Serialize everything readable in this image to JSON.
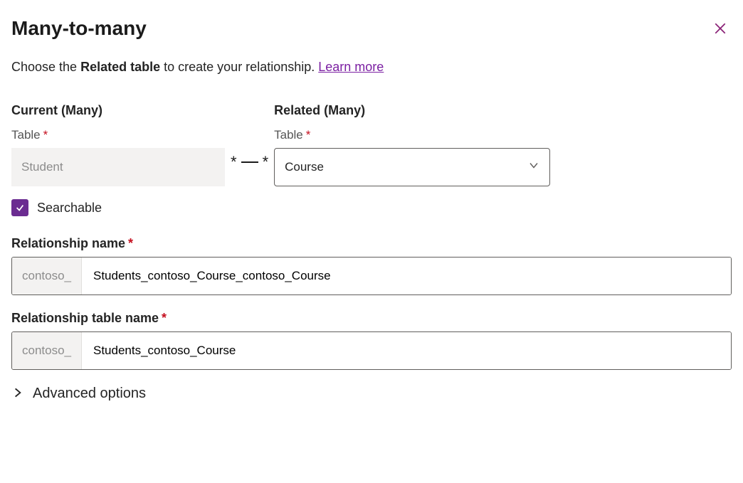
{
  "header": {
    "title": "Many-to-many"
  },
  "subhead": {
    "prefix": "Choose the ",
    "bold": "Related table",
    "suffix": " to create your relationship. ",
    "learn_more": "Learn more"
  },
  "current": {
    "heading": "Current (Many)",
    "table_label": "Table",
    "value": "Student"
  },
  "connector": {
    "left": "*",
    "right": "*"
  },
  "related": {
    "heading": "Related (Many)",
    "table_label": "Table",
    "value": "Course"
  },
  "searchable": {
    "checked": true,
    "label": "Searchable"
  },
  "rel_name": {
    "label": "Relationship name",
    "prefix": "contoso_",
    "value": "Students_contoso_Course_contoso_Course"
  },
  "rel_table": {
    "label": "Relationship table name",
    "prefix": "contoso_",
    "value": "Students_contoso_Course"
  },
  "advanced": {
    "label": "Advanced options"
  }
}
